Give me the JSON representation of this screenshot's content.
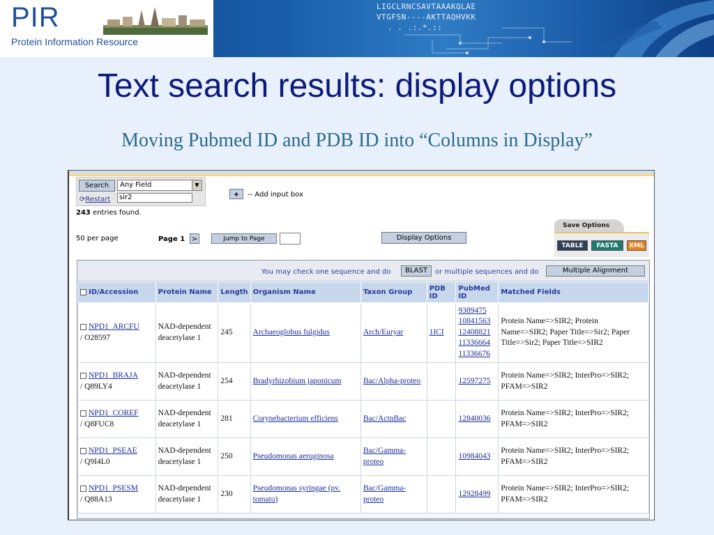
{
  "banner": {
    "logo_letters": "PIR",
    "logo_subtitle": "Protein Information Resource",
    "seq_line1": "LIGCLRNCSAVTAAAKQLAE",
    "seq_line2": "VTGFSN----AKTTAQHVKK",
    "seq_line3": ". .      .:.*.::"
  },
  "slide": {
    "title": "Text search results: display options",
    "subtitle": "Moving Pubmed ID and PDB ID into “Columns in Display”"
  },
  "search": {
    "search_button": "Search",
    "field_select": "Any Field",
    "restart_link": "Restart",
    "query_value": "sir2",
    "add_button": "+",
    "add_label": "-- Add input box"
  },
  "results_meta": {
    "count": "243",
    "count_suffix": " entries found.",
    "per_page": "50 per page",
    "page_label": "Page 1",
    "page_next": ">",
    "jump_button": "Jump to Page",
    "display_options_button": "Display Options"
  },
  "save": {
    "tab_label": "Save Options",
    "table_btn": "TABLE",
    "fasta_btn": "FASTA",
    "xml_btn": "XML",
    "colors": {
      "table": "#2f3f55",
      "fasta": "#1c7a70",
      "xml": "#e8801c"
    }
  },
  "infobar": {
    "text1": "You may check one sequence and do",
    "blast_button": "BLAST",
    "text2": "or multiple sequences and do",
    "multi_button": "Multiple Alignment"
  },
  "table": {
    "headers": [
      "ID/Accession",
      "Protein Name",
      "Length",
      "Organism Name",
      "Taxon Group",
      "PDB ID",
      "PubMed ID",
      "Matched Fields"
    ],
    "rows": [
      {
        "id": "NPD1_ARCFU",
        "acc": "/ O28597",
        "protein": "NAD-dependent deacetylase 1",
        "length": "245",
        "organism": "Archaeoglobus fulgidus",
        "taxon": "Arch/Euryar",
        "pdb": "1ICI",
        "pubmed": [
          "9389475",
          "10841563",
          "12408821",
          "11336664",
          "11336676"
        ],
        "matched": "Protein Name=>SIR2; Protein Name=>SIR2; Paper Title=>Sir2; Paper Title=>Sir2; Paper Title=>SIR2"
      },
      {
        "id": "NPD1_BRAJA",
        "acc": "/ Q89LY4",
        "protein": "NAD-dependent deacetylase 1",
        "length": "254",
        "organism": "Bradyrhizobium japonicum",
        "taxon": "Bac/Alpha-proteo",
        "pdb": "",
        "pubmed": [
          "12597275"
        ],
        "matched": "Protein Name=>SIR2; InterPro=>SIR2; PFAM=>SIR2"
      },
      {
        "id": "NPD1_COREF",
        "acc": "/ Q8FUC8",
        "protein": "NAD-dependent deacetylase 1",
        "length": "281",
        "organism": "Corynebacterium efficiens",
        "taxon": "Bac/ActnBac",
        "pdb": "",
        "pubmed": [
          "12840036"
        ],
        "matched": "Protein Name=>SIR2; InterPro=>SIR2; PFAM=>SIR2"
      },
      {
        "id": "NPD1_PSEAE",
        "acc": "/ Q9I4L0",
        "protein": "NAD-dependent deacetylase 1",
        "length": "250",
        "organism": "Pseudomonas aeruginosa",
        "taxon": "Bac/Gamma-proteo",
        "pdb": "",
        "pubmed": [
          "10984043"
        ],
        "matched": "Protein Name=>SIR2; InterPro=>SIR2; PFAM=>SIR2"
      },
      {
        "id": "NPD1_PSESM",
        "acc": "/ Q88A13",
        "protein": "NAD-dependent deacetylase 1",
        "length": "230",
        "organism": "Pseudomonas syringae (pv. tomato)",
        "taxon": "Bac/Gamma-proteo",
        "pdb": "",
        "pubmed": [
          "12928499"
        ],
        "matched": "Protein Name=>SIR2; InterPro=>SIR2; PFAM=>SIR2"
      }
    ]
  }
}
